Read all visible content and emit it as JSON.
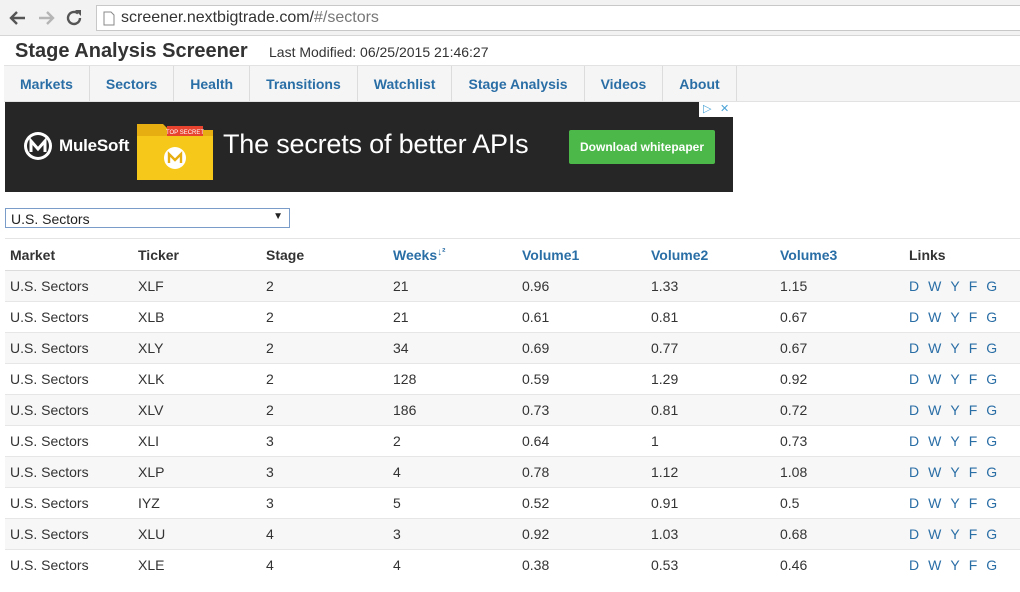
{
  "browser": {
    "url_host": "screener.nextbigtrade.com/",
    "url_path": "#/sectors"
  },
  "header": {
    "title": "Stage Analysis Screener",
    "last_modified": "Last Modified: 06/25/2015 21:46:27"
  },
  "nav": {
    "tabs": [
      "Markets",
      "Sectors",
      "Health",
      "Transitions",
      "Watchlist",
      "Stage Analysis",
      "Videos",
      "About"
    ]
  },
  "ad": {
    "brand": "MuleSoft",
    "folder_label": "TOP SECRET",
    "headline": "The secrets of better APIs",
    "cta": "Download whitepaper",
    "colors": {
      "background": "#262626",
      "cta": "#4cb849",
      "folder": "#f6c81a"
    }
  },
  "market_select": {
    "value": "U.S. Sectors"
  },
  "table": {
    "columns": [
      "Market",
      "Ticker",
      "Stage",
      "Weeks",
      "Volume1",
      "Volume2",
      "Volume3",
      "Links"
    ],
    "link_labels": [
      "D",
      "W",
      "Y",
      "F",
      "G"
    ],
    "rows": [
      [
        "U.S. Sectors",
        "XLF",
        "2",
        "21",
        "0.96",
        "1.33",
        "1.15"
      ],
      [
        "U.S. Sectors",
        "XLB",
        "2",
        "21",
        "0.61",
        "0.81",
        "0.67"
      ],
      [
        "U.S. Sectors",
        "XLY",
        "2",
        "34",
        "0.69",
        "0.77",
        "0.67"
      ],
      [
        "U.S. Sectors",
        "XLK",
        "2",
        "128",
        "0.59",
        "1.29",
        "0.92"
      ],
      [
        "U.S. Sectors",
        "XLV",
        "2",
        "186",
        "0.73",
        "0.81",
        "0.72"
      ],
      [
        "U.S. Sectors",
        "XLI",
        "3",
        "2",
        "0.64",
        "1",
        "0.73"
      ],
      [
        "U.S. Sectors",
        "XLP",
        "3",
        "4",
        "0.78",
        "1.12",
        "1.08"
      ],
      [
        "U.S. Sectors",
        "IYZ",
        "3",
        "5",
        "0.52",
        "0.91",
        "0.5"
      ],
      [
        "U.S. Sectors",
        "XLU",
        "4",
        "3",
        "0.92",
        "1.03",
        "0.68"
      ],
      [
        "U.S. Sectors",
        "XLE",
        "4",
        "4",
        "0.38",
        "0.53",
        "0.46"
      ]
    ]
  },
  "colors": {
    "link": "#2a6ea6",
    "row_stripe": "#f7f7f7"
  }
}
